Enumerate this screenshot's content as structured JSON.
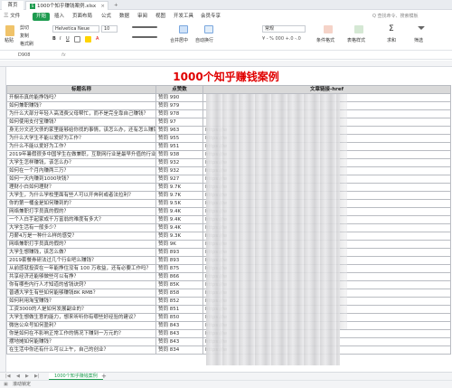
{
  "titlebar": {
    "home_tab": "首页",
    "file_tab": "1000个知乎赚钱案例.xlsx",
    "close_glyph": "×",
    "add_glyph": "+"
  },
  "menubar": {
    "items": [
      "三 文件",
      "开始",
      "插入",
      "页面布局",
      "公式",
      "数据",
      "审阅",
      "视图",
      "开发工具",
      "会员专享"
    ],
    "active_index": 1,
    "search_placeholder": "Q 查找命令、搜索模板"
  },
  "ribbon": {
    "paste": "粘贴",
    "cut": "剪切",
    "copy": "复制",
    "format_painter": "格式刷",
    "font_name": "Helvetica Neue",
    "font_size": "10",
    "merge_center": "合并居中",
    "auto_wrap": "自动换行",
    "number_format": "常规",
    "conditional_format": "条件格式",
    "table_style": "表格样式",
    "sum": "求和",
    "filter": "筛选"
  },
  "formulabar": {
    "name_box": "D908",
    "fx": "fx"
  },
  "sheet": {
    "title": "1000个知乎赚钱案例",
    "headers": [
      "标题名称",
      "点赞数",
      "文章链接-href"
    ],
    "link_prefix": "https://w",
    "rows": [
      {
        "title": "开橱币真的能挣钱吗？",
        "likes": "赞同 990",
        "link": ""
      },
      {
        "title": "如何兼职赚钱？",
        "likes": "赞同 979",
        "link": ""
      },
      {
        "title": "为什么大部分年轻人高消费父母帮忙，而不是完全靠自己赚钱？",
        "likes": "赞同 978",
        "link": ""
      },
      {
        "title": "如何使用支付宝赚钱？",
        "likes": "赞同 97",
        "link": ""
      },
      {
        "title": "身无分文还欠债的家里能够给你找的事情，该怎么办，还有怎么赚钱？",
        "likes": "赞同 963",
        "link": "https://w"
      },
      {
        "title": "为什么大学生不能以爱好为工作？",
        "likes": "赞同 955",
        "link": "https://w"
      },
      {
        "title": "为什么不能以爱好为工作？",
        "likes": "赞同 951",
        "link": "https://w"
      },
      {
        "title": "2019年暑假很多中国学生在做兼职，互联网行业是最早升值的行业？",
        "likes": "赞同 938",
        "link": "https://w"
      },
      {
        "title": "大学生怎样赚钱，该怎么办？",
        "likes": "赞同 932",
        "link": "https://w"
      },
      {
        "title": "如何在一个月内赚两三万？",
        "likes": "赞同 932",
        "link": "https://w"
      },
      {
        "title": "如何一天内赚到1000块钱？",
        "likes": "赞同 927",
        "link": "https://w"
      },
      {
        "title": "理财小白如何理财？",
        "likes": "赞同 9.7K",
        "link": "https://w"
      },
      {
        "title": "大学生，为什么学校里面有些人可以开奔利或者法拉利？",
        "likes": "赞同 9.7K",
        "link": "https://w"
      },
      {
        "title": "你的第一桶金是如何赚到的？",
        "likes": "赞同 9.5K",
        "link": "https://w"
      },
      {
        "title": "网络兼职打字员真的假的？",
        "likes": "赞同 9.4K",
        "link": "https://w"
      },
      {
        "title": "一个人白手起家成千万富翁的难度有多大？",
        "likes": "赞同 9.4K",
        "link": "https://w"
      },
      {
        "title": "大学生活有一般多少？",
        "likes": "赞同 9.4K",
        "link": "https://w"
      },
      {
        "title": "月薪4万是一种什么样的感受？",
        "likes": "赞同 9.3K",
        "link": "https://w"
      },
      {
        "title": "网络兼职打字员真的假的？",
        "likes": "赞同 9K",
        "link": "https://w"
      },
      {
        "title": "大学生想赚钱，该怎么做？",
        "likes": "赞同 893",
        "link": "https://w"
      },
      {
        "title": "2019套餐券研法过几个行业吧么赚钱？",
        "likes": "赞同 893",
        "link": "https://w"
      },
      {
        "title": "从前感就投资在一年能挣住没有 100 万收益，还有必要工作吗？",
        "likes": "赞同 875",
        "link": "https://w"
      },
      {
        "title": "共享经济还能够做些可以有挣？",
        "likes": "赞同 866",
        "link": "https://w"
      },
      {
        "title": "你有哪些内行人才知道的省钱诀窍？",
        "likes": "赞同 85K",
        "link": "https://w"
      },
      {
        "title": "普通大学生有些如何能够赚钱8K RMB？",
        "likes": "赞同 858",
        "link": "https://w"
      },
      {
        "title": "如何利用淘宝赚钱？",
        "likes": "赞同 852",
        "link": "https://w"
      },
      {
        "title": "工资3000的人是如何发展副业的？",
        "likes": "赞同 851",
        "link": "https://w"
      },
      {
        "title": "大学生想做生意的能力，想来听听你有哪些好经验的建议？",
        "likes": "赞同 850",
        "link": "https://w"
      },
      {
        "title": "微信公众号如何盈利？",
        "likes": "赞同 843",
        "link": "https://w"
      },
      {
        "title": "你是如何在不影响正常工作的情况下赚到一万元的？",
        "likes": "赞同 843",
        "link": "https://w"
      },
      {
        "title": "摆地摊如何能赚钱？",
        "likes": "赞同 843",
        "link": "https://w"
      },
      {
        "title": "在生活中你还有什么可以上午，自己的创业？",
        "likes": "赞同 834",
        "link": "https://w"
      }
    ]
  },
  "sheetbar": {
    "tab_label": "1000个知乎赚钱案例",
    "add_glyph": "+"
  },
  "statusbar": {
    "text": "滚动锁定"
  },
  "colors": {
    "accent": "#1d9b4f",
    "title_red": "#e00000",
    "header_gray": "#d9d9d9"
  }
}
